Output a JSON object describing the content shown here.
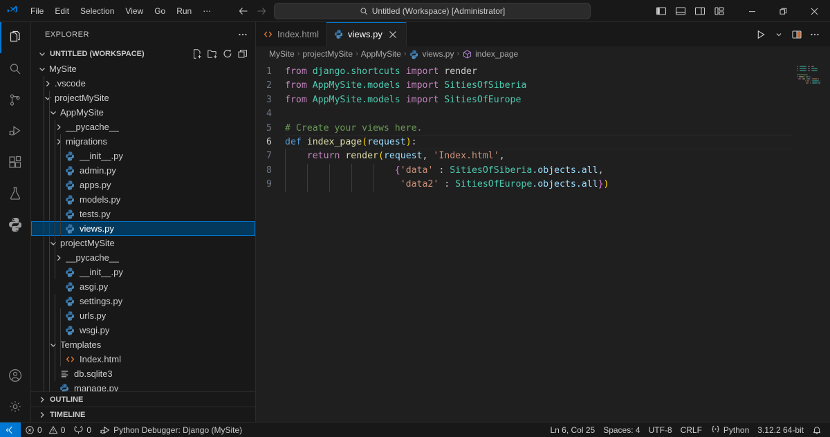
{
  "titlebar": {
    "logo_icon": "vscode-logo-icon",
    "menus": [
      "File",
      "Edit",
      "Selection",
      "View",
      "Go",
      "Run",
      "⋯"
    ],
    "nav_back_icon": "arrow-left-icon",
    "nav_forward_icon": "arrow-right-icon",
    "command_center": {
      "search_icon": "search-icon",
      "text": "Untitled (Workspace) [Administrator]"
    },
    "layout_controls": [
      {
        "name": "toggle-primary-sidebar",
        "icon": "panel-left-icon"
      },
      {
        "name": "toggle-panel",
        "icon": "panel-bottom-icon"
      },
      {
        "name": "toggle-secondary-sidebar",
        "icon": "panel-right-icon"
      },
      {
        "name": "customize-layout",
        "icon": "layout-grid-icon"
      }
    ],
    "window_controls": [
      {
        "name": "minimize-window-button",
        "glyph": "─"
      },
      {
        "name": "restore-window-button",
        "glyph": "❐"
      },
      {
        "name": "close-window-button",
        "glyph": "✕"
      }
    ]
  },
  "activitybar": {
    "items": [
      {
        "name": "activity-explorer",
        "icon": "files-icon",
        "active": true
      },
      {
        "name": "activity-search",
        "icon": "search-icon",
        "active": false
      },
      {
        "name": "activity-source-control",
        "icon": "source-control-icon",
        "active": false
      },
      {
        "name": "activity-run-and-debug",
        "icon": "run-debug-icon",
        "active": false
      },
      {
        "name": "activity-extensions",
        "icon": "extensions-icon",
        "active": false
      },
      {
        "name": "activity-testing",
        "icon": "beaker-icon",
        "active": false
      },
      {
        "name": "activity-python",
        "icon": "python-icon",
        "active": false
      }
    ],
    "bottom": [
      {
        "name": "activity-accounts",
        "icon": "account-icon"
      },
      {
        "name": "activity-settings",
        "icon": "gear-icon"
      }
    ]
  },
  "sidebar": {
    "title": "EXPLORER",
    "more_actions_icon": "ellipsis-icon",
    "workspace": {
      "label": "UNTITLED (WORKSPACE)",
      "expanded": true,
      "actions": [
        {
          "name": "new-file-button",
          "icon": "new-file-icon"
        },
        {
          "name": "new-folder-button",
          "icon": "new-folder-icon"
        },
        {
          "name": "refresh-explorer-button",
          "icon": "refresh-icon"
        },
        {
          "name": "collapse-folders-button",
          "icon": "collapse-all-icon"
        }
      ]
    },
    "tree": [
      {
        "label": "MySite",
        "depth": 1,
        "type": "folder",
        "state": "expanded",
        "selected": false
      },
      {
        "label": ".vscode",
        "depth": 2,
        "type": "folder",
        "state": "collapsed",
        "selected": false
      },
      {
        "label": "projectMySite",
        "depth": 2,
        "type": "folder",
        "state": "expanded",
        "selected": false
      },
      {
        "label": "AppMySite",
        "depth": 3,
        "type": "folder",
        "state": "expanded",
        "selected": false
      },
      {
        "label": "__pycache__",
        "depth": 4,
        "type": "folder",
        "state": "collapsed",
        "selected": false
      },
      {
        "label": "migrations",
        "depth": 4,
        "type": "folder",
        "state": "collapsed",
        "selected": false
      },
      {
        "label": "__init__.py",
        "depth": 4,
        "type": "python",
        "state": "file",
        "selected": false
      },
      {
        "label": "admin.py",
        "depth": 4,
        "type": "python",
        "state": "file",
        "selected": false
      },
      {
        "label": "apps.py",
        "depth": 4,
        "type": "python",
        "state": "file",
        "selected": false
      },
      {
        "label": "models.py",
        "depth": 4,
        "type": "python",
        "state": "file",
        "selected": false
      },
      {
        "label": "tests.py",
        "depth": 4,
        "type": "python",
        "state": "file",
        "selected": false
      },
      {
        "label": "views.py",
        "depth": 4,
        "type": "python",
        "state": "file",
        "selected": true
      },
      {
        "label": "projectMySite",
        "depth": 3,
        "type": "folder",
        "state": "expanded",
        "selected": false
      },
      {
        "label": "__pycache__",
        "depth": 4,
        "type": "folder",
        "state": "collapsed",
        "selected": false
      },
      {
        "label": "__init__.py",
        "depth": 4,
        "type": "python",
        "state": "file",
        "selected": false
      },
      {
        "label": "asgi.py",
        "depth": 4,
        "type": "python",
        "state": "file",
        "selected": false
      },
      {
        "label": "settings.py",
        "depth": 4,
        "type": "python",
        "state": "file",
        "selected": false
      },
      {
        "label": "urls.py",
        "depth": 4,
        "type": "python",
        "state": "file",
        "selected": false
      },
      {
        "label": "wsgi.py",
        "depth": 4,
        "type": "python",
        "state": "file",
        "selected": false
      },
      {
        "label": "Templates",
        "depth": 3,
        "type": "folder",
        "state": "expanded",
        "selected": false
      },
      {
        "label": "Index.html",
        "depth": 4,
        "type": "html",
        "state": "file",
        "selected": false
      },
      {
        "label": "db.sqlite3",
        "depth": 3,
        "type": "db",
        "state": "file",
        "selected": false
      },
      {
        "label": "manage.py",
        "depth": 3,
        "type": "python",
        "state": "file",
        "selected": false
      }
    ],
    "outline": {
      "label": "OUTLINE",
      "expanded": false
    },
    "timeline": {
      "label": "TIMELINE",
      "expanded": false
    }
  },
  "editor": {
    "tabs": [
      {
        "label": "Index.html",
        "icon": "html-icon",
        "active": false,
        "dirty": false
      },
      {
        "label": "views.py",
        "icon": "python-icon",
        "active": true,
        "dirty": false,
        "close_icon": "close-icon"
      }
    ],
    "actions": [
      {
        "name": "run-python-file-button",
        "icon": "play-icon"
      },
      {
        "name": "run-options-dropdown",
        "icon": "chevron-down-icon"
      },
      {
        "name": "split-editor-right-button",
        "icon": "split-editor-icon"
      },
      {
        "name": "more-editor-actions-button",
        "icon": "ellipsis-icon"
      }
    ],
    "breadcrumbs": [
      {
        "label": "MySite",
        "icon": null
      },
      {
        "label": "projectMySite",
        "icon": null
      },
      {
        "label": "AppMySite",
        "icon": null
      },
      {
        "label": "views.py",
        "icon": "python-icon"
      },
      {
        "label": "index_page",
        "icon": "symbol-method-icon"
      }
    ],
    "code_lines": [
      {
        "num": 1,
        "current": false,
        "guides": 0,
        "tokens": [
          {
            "t": "from ",
            "c": "t-kw"
          },
          {
            "t": "django.shortcuts ",
            "c": "t-cls"
          },
          {
            "t": "import ",
            "c": "t-kw"
          },
          {
            "t": "render",
            "c": "t-pl"
          }
        ]
      },
      {
        "num": 2,
        "current": false,
        "guides": 0,
        "tokens": [
          {
            "t": "from ",
            "c": "t-kw"
          },
          {
            "t": "AppMySite.models ",
            "c": "t-cls"
          },
          {
            "t": "import ",
            "c": "t-kw"
          },
          {
            "t": "SitiesOfSiberia",
            "c": "t-cls"
          }
        ]
      },
      {
        "num": 3,
        "current": false,
        "guides": 0,
        "tokens": [
          {
            "t": "from ",
            "c": "t-kw"
          },
          {
            "t": "AppMySite.models ",
            "c": "t-cls"
          },
          {
            "t": "import ",
            "c": "t-kw"
          },
          {
            "t": "SitiesOfEurope",
            "c": "t-cls"
          }
        ]
      },
      {
        "num": 4,
        "current": false,
        "guides": 0,
        "tokens": []
      },
      {
        "num": 5,
        "current": false,
        "guides": 0,
        "tokens": [
          {
            "t": "# Create your views here.",
            "c": "t-cmt"
          }
        ]
      },
      {
        "num": 6,
        "current": true,
        "guides": 0,
        "tokens": [
          {
            "t": "def ",
            "c": "t-def"
          },
          {
            "t": "index_page",
            "c": "t-fn"
          },
          {
            "t": "(",
            "c": "t-p1"
          },
          {
            "t": "request",
            "c": "t-var"
          },
          {
            "t": ")",
            "c": "t-p1"
          },
          {
            "t": ":",
            "c": "t-pl"
          }
        ]
      },
      {
        "num": 7,
        "current": false,
        "guides": 1,
        "tokens": [
          {
            "t": "    ",
            "c": "t-pl"
          },
          {
            "t": "return ",
            "c": "t-kw"
          },
          {
            "t": "render",
            "c": "t-fn"
          },
          {
            "t": "(",
            "c": "t-p1"
          },
          {
            "t": "request",
            "c": "t-var"
          },
          {
            "t": ", ",
            "c": "t-pl"
          },
          {
            "t": "'Index.html'",
            "c": "t-str"
          },
          {
            "t": ",",
            "c": "t-pl"
          }
        ]
      },
      {
        "num": 8,
        "current": false,
        "guides": 5,
        "tokens": [
          {
            "t": "                    ",
            "c": "t-pl"
          },
          {
            "t": "{",
            "c": "t-p2"
          },
          {
            "t": "'data'",
            "c": "t-str"
          },
          {
            "t": " : ",
            "c": "t-pl"
          },
          {
            "t": "SitiesOfSiberia",
            "c": "t-cls"
          },
          {
            "t": ".objects.",
            "c": "t-var"
          },
          {
            "t": "all",
            "c": "t-var"
          },
          {
            "t": ",",
            "c": "t-pl"
          }
        ]
      },
      {
        "num": 9,
        "current": false,
        "guides": 5,
        "tokens": [
          {
            "t": "                     ",
            "c": "t-pl"
          },
          {
            "t": "'data2'",
            "c": "t-str"
          },
          {
            "t": " : ",
            "c": "t-pl"
          },
          {
            "t": "SitiesOfEurope",
            "c": "t-cls"
          },
          {
            "t": ".objects.",
            "c": "t-var"
          },
          {
            "t": "all",
            "c": "t-var"
          },
          {
            "t": "}",
            "c": "t-p2"
          },
          {
            "t": ")",
            "c": "t-p1"
          }
        ]
      }
    ]
  },
  "statusbar": {
    "remote_icon": "remote-window-icon",
    "left": [
      {
        "name": "status-problems",
        "icon": "error-icon",
        "errors": "0",
        "warn_icon": "warning-icon",
        "warnings": "0"
      },
      {
        "name": "status-ports",
        "icon": "ports-icon",
        "text": "0"
      },
      {
        "name": "status-debug-config",
        "icon": "debug-alt-icon",
        "text": "Python Debugger: Django (MySite)"
      }
    ],
    "right": [
      {
        "name": "status-cursor-position",
        "text": "Ln 6, Col 25"
      },
      {
        "name": "status-indentation",
        "text": "Spaces: 4"
      },
      {
        "name": "status-encoding",
        "text": "UTF-8"
      },
      {
        "name": "status-eol",
        "text": "CRLF"
      },
      {
        "name": "status-language-mode",
        "icon": "python-brackets-icon",
        "text": "Python"
      },
      {
        "name": "status-python-interpreter",
        "text": "3.12.2 64-bit"
      },
      {
        "name": "status-notifications",
        "icon": "bell-icon"
      }
    ]
  },
  "colors": {
    "accent": "#0078d4",
    "selection": "#04395e",
    "bg": "#1f1f1f",
    "chrome": "#181818"
  }
}
